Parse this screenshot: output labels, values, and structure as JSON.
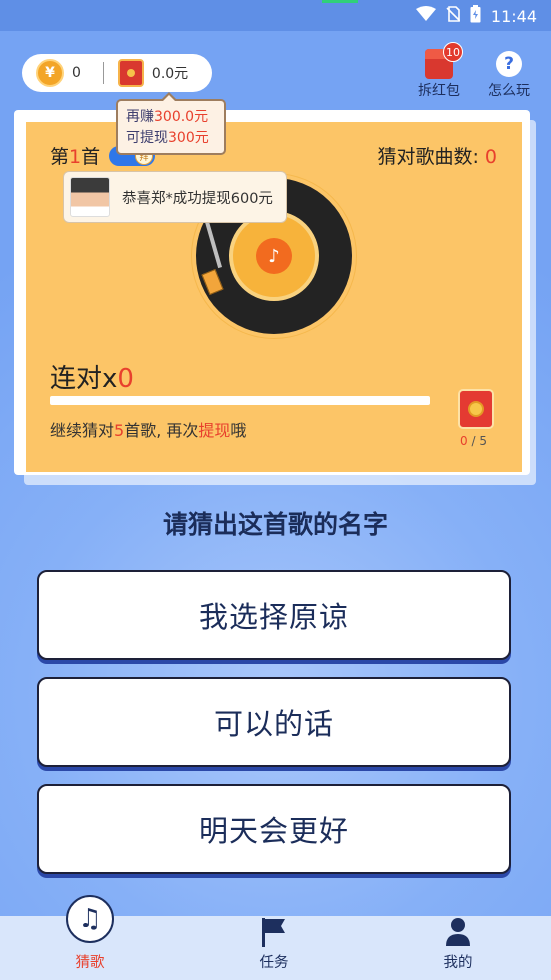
{
  "status_bar": {
    "time": "11:44"
  },
  "header": {
    "coins_value": "0",
    "cash_value": "0.0元",
    "red_packet_label": "拆红包",
    "red_packet_badge": "10",
    "help_label": "怎么玩"
  },
  "tooltip": {
    "line1_prefix": "再赚",
    "line1_amount": "300.0元",
    "line2_prefix": "可提现",
    "line2_amount": "300元"
  },
  "notice": {
    "text": "恭喜郑*成功提现600元"
  },
  "game": {
    "song_prefix": "第",
    "song_number": "1",
    "song_suffix": "首",
    "toggle_glyph": "拜",
    "guessed_label": "猜对歌曲数: ",
    "guessed_value": "0",
    "combo_label": "连对x",
    "combo_value": "0",
    "progress_fraction": 0,
    "hint_prefix": "继续猜对",
    "hint_count": "5",
    "hint_middle": "首歌, 再次",
    "hint_action": "提现",
    "hint_suffix": "哦",
    "reward_current": "0",
    "reward_total": "/ 5"
  },
  "question": "请猜出这首歌的名字",
  "options": [
    "我选择原谅",
    "可以的话",
    "明天会更好"
  ],
  "tabs": [
    {
      "label": "猜歌",
      "icon": "music-note-icon",
      "active": true
    },
    {
      "label": "任务",
      "icon": "flag-icon",
      "active": false
    },
    {
      "label": "我的",
      "icon": "user-icon",
      "active": false
    }
  ],
  "colors": {
    "accent": "#e8402d",
    "card": "#fcc567",
    "background": "#78a6f5",
    "button_text": "#1b2d5a"
  }
}
